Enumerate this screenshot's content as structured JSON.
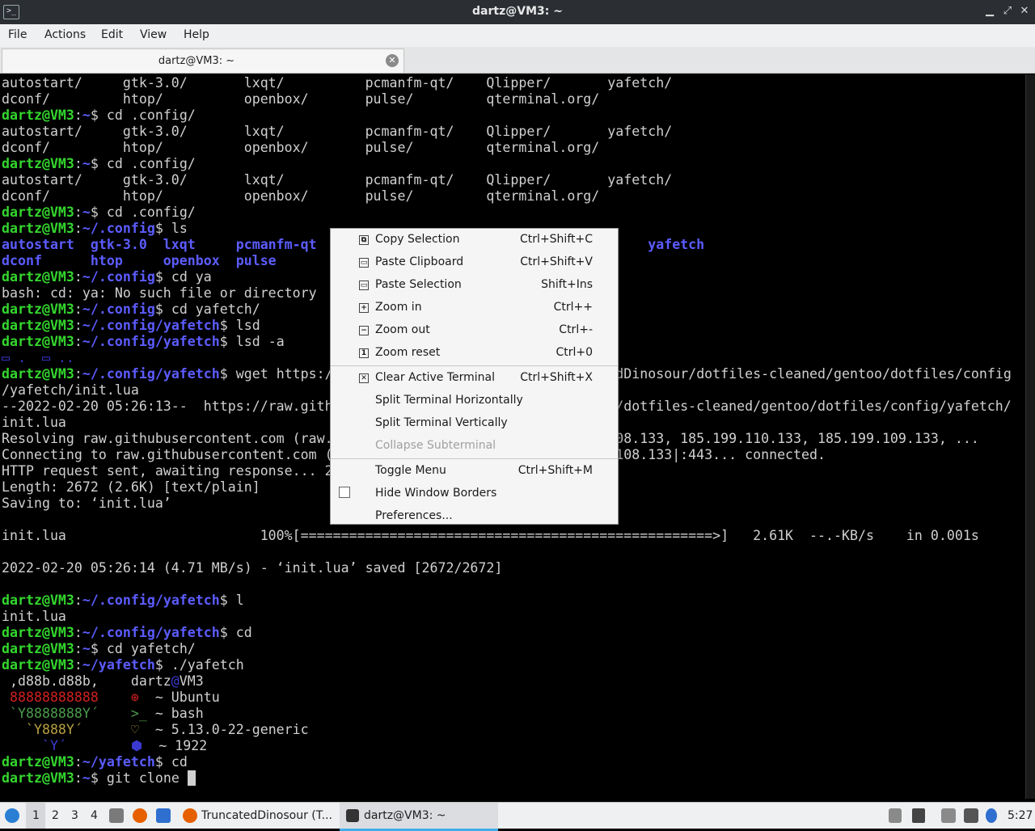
{
  "window": {
    "title": "dartz@VM3: ~",
    "minimize_glyph": "▁",
    "maximize_glyph": "⤢",
    "close_glyph": "✕",
    "app_icon_glyph": ">_"
  },
  "menubar": {
    "items": [
      "File",
      "Actions",
      "Edit",
      "View",
      "Help"
    ]
  },
  "tab": {
    "title": "dartz@VM3: ~",
    "close_glyph": "✕"
  },
  "terminal": {
    "lines": [
      [
        [
          "",
          "autostart/     gtk-3.0/       lxqt/          pcmanfm-qt/    Qlipper/       yafetch/"
        ]
      ],
      [
        [
          "",
          "dconf/         htop/          openbox/       pulse/         qterminal.org/"
        ]
      ],
      [
        [
          "g",
          "dartz@VM3"
        ],
        [
          "",
          ":"
        ],
        [
          "b",
          "~"
        ],
        [
          "",
          "$ cd .config/"
        ]
      ],
      [
        [
          "",
          "autostart/     gtk-3.0/       lxqt/          pcmanfm-qt/    Qlipper/       yafetch/"
        ]
      ],
      [
        [
          "",
          "dconf/         htop/          openbox/       pulse/         qterminal.org/"
        ]
      ],
      [
        [
          "g",
          "dartz@VM3"
        ],
        [
          "",
          ":"
        ],
        [
          "b",
          "~"
        ],
        [
          "",
          "$ cd .config/"
        ]
      ],
      [
        [
          "",
          "autostart/     gtk-3.0/       lxqt/          pcmanfm-qt/    Qlipper/       yafetch/"
        ]
      ],
      [
        [
          "",
          "dconf/         htop/          openbox/       pulse/         qterminal.org/"
        ]
      ],
      [
        [
          "g",
          "dartz@VM3"
        ],
        [
          "",
          ":"
        ],
        [
          "b",
          "~"
        ],
        [
          "",
          "$ cd .config/"
        ]
      ],
      [
        [
          "g",
          "dartz@VM3"
        ],
        [
          "",
          ":"
        ],
        [
          "b",
          "~/.config"
        ],
        [
          "",
          "$ ls"
        ]
      ],
      [
        [
          "b",
          "autostart  gtk-3.0  lxqt     pcmanfm-qt                                         yafetch"
        ]
      ],
      [
        [
          "b",
          "dconf      htop     openbox  pulse"
        ]
      ],
      [
        [
          "g",
          "dartz@VM3"
        ],
        [
          "",
          ":"
        ],
        [
          "b",
          "~/.config"
        ],
        [
          "",
          "$ cd ya"
        ]
      ],
      [
        [
          "",
          "bash: cd: ya: No such file or directory"
        ]
      ],
      [
        [
          "g",
          "dartz@VM3"
        ],
        [
          "",
          ":"
        ],
        [
          "b",
          "~/.config"
        ],
        [
          "",
          "$ cd yafetch/"
        ]
      ],
      [
        [
          "g",
          "dartz@VM3"
        ],
        [
          "",
          ":"
        ],
        [
          "b",
          "~/.config/yafetch"
        ],
        [
          "",
          "$ lsd"
        ]
      ],
      [
        [
          "g",
          "dartz@VM3"
        ],
        [
          "",
          ":"
        ],
        [
          "b",
          "~/.config/yafetch"
        ],
        [
          "",
          "$ lsd -a"
        ]
      ],
      [
        [
          "bl",
          "▭ .  ▭ .."
        ]
      ],
      [
        [
          "g",
          "dartz@VM3"
        ],
        [
          "",
          ":"
        ],
        [
          "b",
          "~/.config/yafetch"
        ],
        [
          "",
          "$ wget https://raw.githubusercontent.com/TruncatedDinosour/dotfiles-cleaned/gentoo/dotfiles/config"
        ]
      ],
      [
        [
          "",
          "/yafetch/init.lua"
        ]
      ],
      [
        [
          "",
          "--2022-02-20 05:26:13--  https://raw.githubusercontent.com/TruncatedDinosour/dotfiles-cleaned/gentoo/dotfiles/config/yafetch/"
        ]
      ],
      [
        [
          "",
          "init.lua"
        ]
      ],
      [
        [
          "",
          "Resolving raw.githubusercontent.com (raw.githubusercontent.com)... 185.199.108.133, 185.199.110.133, 185.199.109.133, ..."
        ]
      ],
      [
        [
          "",
          "Connecting to raw.githubusercontent.com (raw.githubusercontent.com)|185.199.108.133|:443... connected."
        ]
      ],
      [
        [
          "",
          "HTTP request sent, awaiting response... 200 OK"
        ]
      ],
      [
        [
          "",
          "Length: 2672 (2.6K) [text/plain]"
        ]
      ],
      [
        [
          "",
          "Saving to: ‘init.lua’"
        ]
      ],
      [
        [
          "",
          ""
        ]
      ],
      [
        [
          "",
          "init.lua                        100%[===================================================>]   2.61K  --.-KB/s    in 0.001s"
        ]
      ],
      [
        [
          "",
          ""
        ]
      ],
      [
        [
          "",
          "2022-02-20 05:26:14 (4.71 MB/s) - ‘init.lua’ saved [2672/2672]"
        ]
      ],
      [
        [
          "",
          ""
        ]
      ],
      [
        [
          "g",
          "dartz@VM3"
        ],
        [
          "",
          ":"
        ],
        [
          "b",
          "~/.config/yafetch"
        ],
        [
          "",
          "$ l"
        ]
      ],
      [
        [
          "",
          "init.lua"
        ]
      ],
      [
        [
          "g",
          "dartz@VM3"
        ],
        [
          "",
          ":"
        ],
        [
          "b",
          "~/.config/yafetch"
        ],
        [
          "",
          "$ cd"
        ]
      ],
      [
        [
          "g",
          "dartz@VM3"
        ],
        [
          "",
          ":"
        ],
        [
          "b",
          "~"
        ],
        [
          "",
          "$ cd yafetch/"
        ]
      ],
      [
        [
          "g",
          "dartz@VM3"
        ],
        [
          "",
          ":"
        ],
        [
          "b",
          "~/yafetch"
        ],
        [
          "",
          "$ ./yafetch"
        ]
      ],
      [
        [
          "",
          " ,d88b.d88b,    dartz"
        ],
        [
          "bl",
          "@"
        ],
        [
          "",
          "VM3"
        ]
      ],
      [
        [
          "r",
          " 88888888888    ⊕"
        ],
        [
          "",
          "  ~ Ubuntu"
        ]
      ],
      [
        [
          "gy",
          " `Y8888888Y´    >_"
        ],
        [
          "",
          " ~ bash"
        ]
      ],
      [
        [
          "yl",
          "   `Y888Y´      ♡"
        ],
        [
          "",
          "  ~ 5.13.0-22-generic"
        ]
      ],
      [
        [
          "bl",
          "     `Y´        ⬢"
        ],
        [
          "",
          "  ~ 1922"
        ]
      ],
      [
        [
          "g",
          "dartz@VM3"
        ],
        [
          "",
          ":"
        ],
        [
          "b",
          "~/yafetch"
        ],
        [
          "",
          "$ cd"
        ]
      ],
      [
        [
          "g",
          "dartz@VM3"
        ],
        [
          "",
          ":"
        ],
        [
          "b",
          "~"
        ],
        [
          "",
          "$ git clone "
        ],
        [
          "cur",
          " "
        ]
      ]
    ]
  },
  "context_menu": {
    "items": [
      {
        "kind": "item",
        "label": "Copy Selection",
        "shortcut": "Ctrl+Shift+C",
        "icon": "copy-icon",
        "glyph": "⧉"
      },
      {
        "kind": "item",
        "label": "Paste Clipboard",
        "shortcut": "Ctrl+Shift+V",
        "icon": "paste-icon",
        "glyph": "▭"
      },
      {
        "kind": "item",
        "label": "Paste Selection",
        "shortcut": "Shift+Ins",
        "icon": "paste-icon",
        "glyph": "▭"
      },
      {
        "kind": "item",
        "label": "Zoom in",
        "shortcut": "Ctrl++",
        "icon": "zoom-in-icon",
        "glyph": "+"
      },
      {
        "kind": "item",
        "label": "Zoom out",
        "shortcut": "Ctrl+-",
        "icon": "zoom-out-icon",
        "glyph": "−"
      },
      {
        "kind": "item",
        "label": "Zoom reset",
        "shortcut": "Ctrl+0",
        "icon": "zoom-reset-icon",
        "glyph": "1"
      },
      {
        "kind": "sep"
      },
      {
        "kind": "item",
        "label": "Clear Active Terminal",
        "shortcut": "Ctrl+Shift+X",
        "icon": "clear-icon",
        "glyph": "✕"
      },
      {
        "kind": "item",
        "label": "Split Terminal Horizontally",
        "shortcut": ""
      },
      {
        "kind": "item",
        "label": "Split Terminal Vertically",
        "shortcut": ""
      },
      {
        "kind": "item",
        "label": "Collapse Subterminal",
        "shortcut": "",
        "disabled": true
      },
      {
        "kind": "sep"
      },
      {
        "kind": "item",
        "label": "Toggle Menu",
        "shortcut": "Ctrl+Shift+M"
      },
      {
        "kind": "item",
        "label": "Hide Window Borders",
        "shortcut": "",
        "checkbox": true,
        "checked": false
      },
      {
        "kind": "item",
        "label": "Preferences...",
        "shortcut": ""
      }
    ]
  },
  "taskbar": {
    "workspaces": [
      "1",
      "2",
      "3",
      "4"
    ],
    "active_workspace": "1",
    "tasks": [
      {
        "label": "TruncatedDinosour (T...",
        "icon": "firefox-icon",
        "active": false
      },
      {
        "label": "dartz@VM3: ~",
        "icon": "terminal-icon",
        "active": true
      }
    ],
    "clock": "5:27",
    "accent": "#3daee9"
  }
}
